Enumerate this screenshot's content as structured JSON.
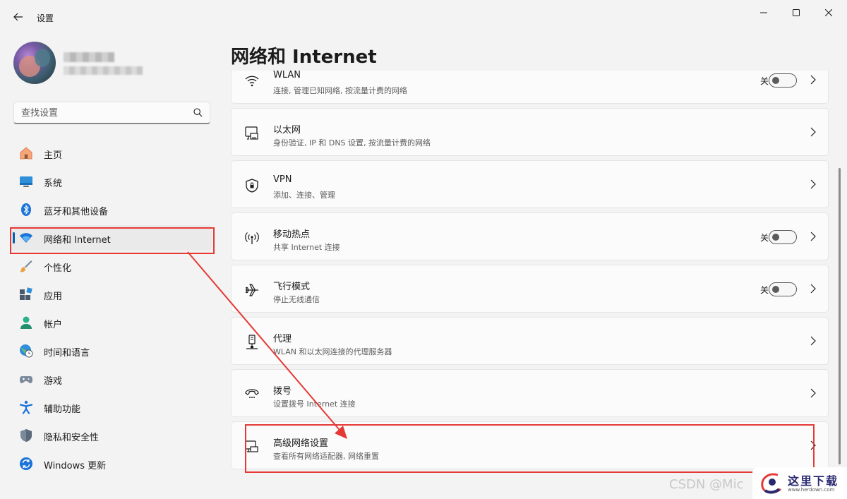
{
  "window": {
    "title": "设置"
  },
  "search": {
    "placeholder": "查找设置"
  },
  "sidebar": {
    "items": [
      {
        "label": "主页",
        "icon": "home-icon"
      },
      {
        "label": "系统",
        "icon": "monitor-icon"
      },
      {
        "label": "蓝牙和其他设备",
        "icon": "bluetooth-icon"
      },
      {
        "label": "网络和 Internet",
        "icon": "wifi-icon",
        "active": true
      },
      {
        "label": "个性化",
        "icon": "brush-icon"
      },
      {
        "label": "应用",
        "icon": "apps-icon"
      },
      {
        "label": "帐户",
        "icon": "account-icon"
      },
      {
        "label": "时间和语言",
        "icon": "globe-clock-icon"
      },
      {
        "label": "游戏",
        "icon": "gamepad-icon"
      },
      {
        "label": "辅助功能",
        "icon": "accessibility-icon"
      },
      {
        "label": "隐私和安全性",
        "icon": "shield-icon"
      },
      {
        "label": "Windows 更新",
        "icon": "update-icon"
      }
    ]
  },
  "main": {
    "title": "网络和 Internet",
    "cards": [
      {
        "title": "WLAN",
        "subtitle": "连接, 管理已知网络, 按流量计费的网络",
        "icon": "wifi-icon",
        "toggle_label": "关",
        "toggle_on": false
      },
      {
        "title": "以太网",
        "subtitle": "身份验证, IP 和 DNS 设置, 按流量计费的网络",
        "icon": "ethernet-icon"
      },
      {
        "title": "VPN",
        "subtitle": "添加、连接、管理",
        "icon": "vpn-shield-icon"
      },
      {
        "title": "移动热点",
        "subtitle": "共享 Internet 连接",
        "icon": "hotspot-icon",
        "toggle_label": "关",
        "toggle_on": false
      },
      {
        "title": "飞行模式",
        "subtitle": "停止无线通信",
        "icon": "airplane-icon",
        "toggle_label": "关",
        "toggle_on": false
      },
      {
        "title": "代理",
        "subtitle": "WLAN 和以太网连接的代理服务器",
        "icon": "proxy-icon"
      },
      {
        "title": "拨号",
        "subtitle": "设置拨号 Internet 连接",
        "icon": "dialup-icon"
      },
      {
        "title": "高级网络设置",
        "subtitle": "查看所有网络适配器, 网络重置",
        "icon": "network-adapter-icon"
      }
    ]
  },
  "overlay": {
    "watermark": "CSDN @Mic",
    "logo_text": "这里下载",
    "logo_sub": "www.herdown.com",
    "annotation_color": "#e53935"
  },
  "colors": {
    "accent": "#005fb8",
    "background": "#f3f3f3",
    "card": "#fbfbfb"
  }
}
